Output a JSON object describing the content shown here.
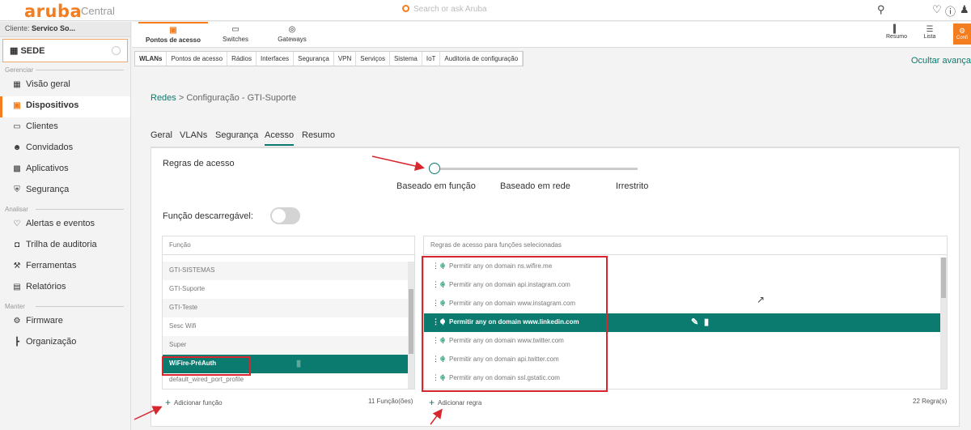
{
  "topbar": {
    "logo": "aruba",
    "logo_sub": "Central",
    "search_placeholder": "Search or ask Aruba",
    "icons": [
      "search-icon",
      "bell-icon",
      "help-icon",
      "user-icon"
    ]
  },
  "sidebar": {
    "client_label": "Cliente:",
    "client_value": "Servico So...",
    "site": "SEDE",
    "sections": {
      "manage": "Gerenciar",
      "analyze": "Analisar",
      "maintain": "Manter"
    },
    "items": [
      {
        "label": "Visão geral",
        "icon": "grid-icon"
      },
      {
        "label": "Dispositivos",
        "icon": "device-icon"
      },
      {
        "label": "Clientes",
        "icon": "clients-icon"
      },
      {
        "label": "Convidados",
        "icon": "guests-icon"
      },
      {
        "label": "Aplicativos",
        "icon": "apps-icon"
      },
      {
        "label": "Segurança",
        "icon": "shield-icon"
      },
      {
        "label": "Alertas e eventos",
        "icon": "bell-icon"
      },
      {
        "label": "Trilha de auditoria",
        "icon": "audit-icon"
      },
      {
        "label": "Ferramentas",
        "icon": "tools-icon"
      },
      {
        "label": "Relatórios",
        "icon": "reports-icon"
      },
      {
        "label": "Firmware",
        "icon": "firmware-icon"
      },
      {
        "label": "Organização",
        "icon": "org-icon"
      }
    ]
  },
  "device_tabs": [
    {
      "label": "Pontos de acesso",
      "active": true
    },
    {
      "label": "Switches"
    },
    {
      "label": "Gateways"
    }
  ],
  "view_buttons": {
    "summary": "Resumo",
    "list": "Lista",
    "config": "Confi"
  },
  "sub_tabs": [
    "WLANs",
    "Pontos de acesso",
    "Rádios",
    "Interfaces",
    "Segurança",
    "VPN",
    "Serviços",
    "Sistema",
    "IoT",
    "Auditoria de configuração"
  ],
  "hide_advanced": "Ocultar avançad",
  "breadcrumb": {
    "link": "Redes",
    "sep": ">",
    "current": "Configuração - GTI-Suporte"
  },
  "config_tabs": [
    "Geral",
    "VLANs",
    "Segurança",
    "Acesso",
    "Resumo"
  ],
  "access": {
    "rules_label": "Regras de acesso",
    "slider_options": [
      "Baseado em função",
      "Baseado em rede",
      "Irrestrito"
    ],
    "slider_selected": "Baseado em função",
    "downloadable_label": "Função descarregável:",
    "downloadable_on": false
  },
  "roles": {
    "header": "Função",
    "items": [
      "GTI-SISTEMAS",
      "GTI-Suporte",
      "GTI-Teste",
      "Sesc Wifi",
      "Super",
      "WiFire-PréAuth",
      "default_wired_port_profile"
    ],
    "selected": "WiFire-PréAuth",
    "add_label": "Adicionar função",
    "count": "11 Função(ões)"
  },
  "rules": {
    "header": "Regras de acesso para funções selecionadas",
    "items": [
      "Permitir any on domain ns.wifire.me",
      "Permitir any on domain api.instagram.com",
      "Permitir any on domain www.instagram.com",
      "Permitir any on domain www.linkedin.com",
      "Permitir any on domain www.twitter.com",
      "Permitir any on domain api.twitter.com",
      "Permitir any on domain ssl.gstatic.com"
    ],
    "selected": "Permitir any on domain www.linkedin.com",
    "add_label": "Adicionar regra",
    "count": "22 Regra(s)"
  },
  "colors": {
    "brand": "#f47d20",
    "accent": "#0b7b6f",
    "highlight": "#d8262f"
  }
}
